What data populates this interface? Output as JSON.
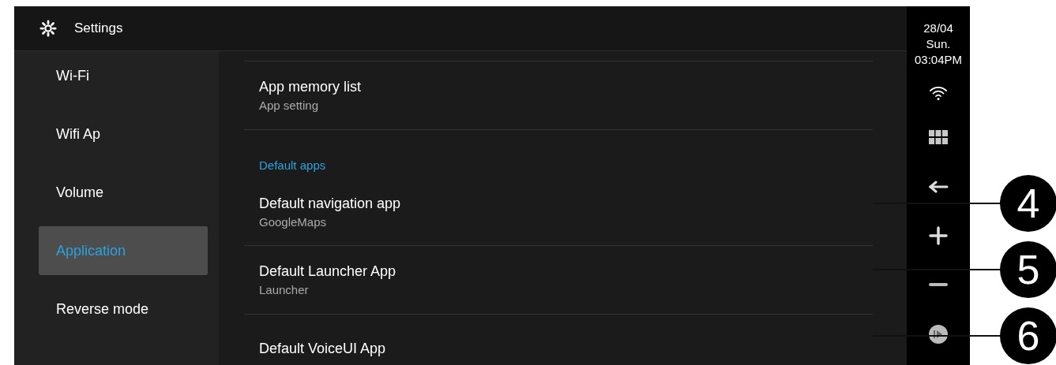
{
  "header": {
    "title": "Settings"
  },
  "sidebar": {
    "items": [
      {
        "label": "Wi-Fi",
        "selected": false
      },
      {
        "label": "Wifi Ap",
        "selected": false
      },
      {
        "label": "Volume",
        "selected": false
      },
      {
        "label": "Application",
        "selected": true
      },
      {
        "label": "Reverse mode",
        "selected": false
      }
    ]
  },
  "content": {
    "items": [
      {
        "kind": "setting",
        "title": "App memory list",
        "summary": "App setting"
      },
      {
        "kind": "category",
        "title": "Default apps"
      },
      {
        "kind": "setting",
        "title": "Default navigation app",
        "summary": "GoogleMaps"
      },
      {
        "kind": "setting",
        "title": "Default Launcher App",
        "summary": "Launcher"
      },
      {
        "kind": "setting",
        "title": "Default VoiceUI App"
      }
    ]
  },
  "status_rail": {
    "date": "28/04",
    "weekday": "Sun.",
    "time": "03:04PM"
  },
  "callouts": [
    {
      "label": "4"
    },
    {
      "label": "5"
    },
    {
      "label": "6"
    }
  ]
}
